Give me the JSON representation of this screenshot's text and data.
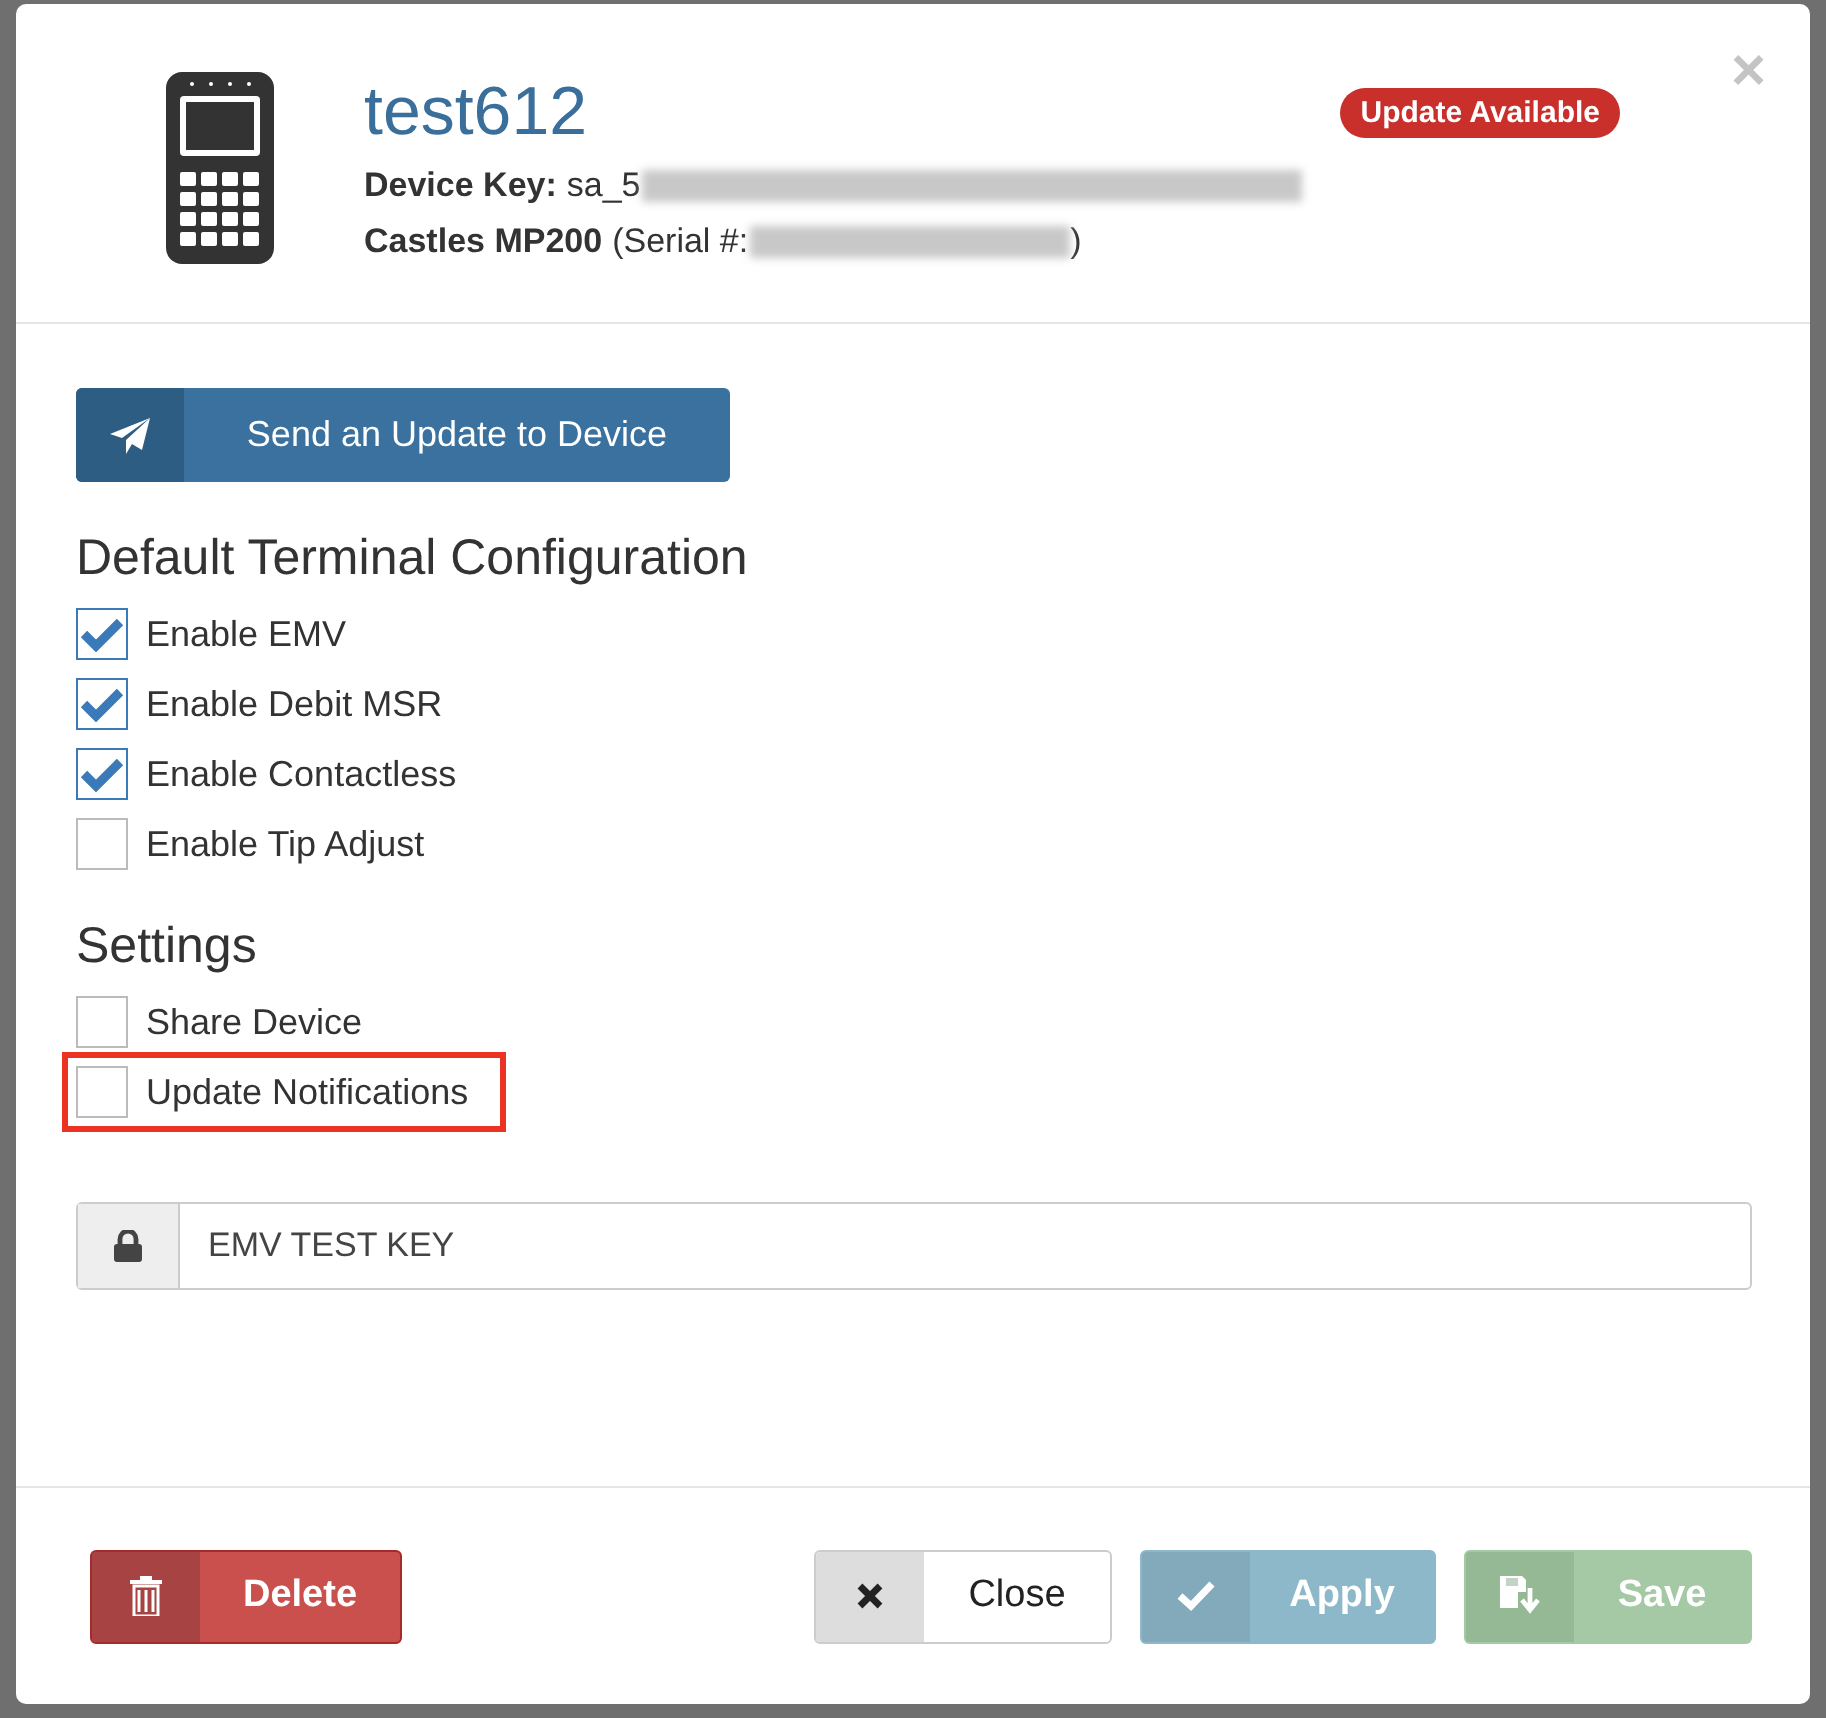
{
  "header": {
    "device_name": "test612",
    "badge": "Update Available",
    "key_label": "Device Key:",
    "key_value": "sa_5",
    "key_redacted": true,
    "model": "Castles MP200",
    "serial_prefix": "(Serial #:",
    "serial_redacted": true,
    "serial_suffix": ")",
    "close_glyph": "×"
  },
  "send_button": {
    "label": "Send an Update to Device"
  },
  "terminal": {
    "title": "Default Terminal Configuration",
    "options": [
      {
        "label": "Enable EMV",
        "checked": true,
        "highlighted": false
      },
      {
        "label": "Enable Debit MSR",
        "checked": true,
        "highlighted": false
      },
      {
        "label": "Enable Contactless",
        "checked": true,
        "highlighted": false
      },
      {
        "label": "Enable Tip Adjust",
        "checked": false,
        "highlighted": false
      }
    ]
  },
  "settings": {
    "title": "Settings",
    "options": [
      {
        "label": "Share Device",
        "checked": false,
        "highlighted": false
      },
      {
        "label": "Update Notifications",
        "checked": false,
        "highlighted": true
      }
    ]
  },
  "key_field": {
    "value": "EMV TEST KEY"
  },
  "footer": {
    "buttons": [
      {
        "kind": "delete",
        "label": "Delete",
        "disabled": false
      },
      {
        "kind": "close",
        "label": "Close",
        "disabled": false
      },
      {
        "kind": "apply",
        "label": "Apply",
        "disabled": true
      },
      {
        "kind": "save",
        "label": "Save",
        "disabled": true
      }
    ]
  }
}
